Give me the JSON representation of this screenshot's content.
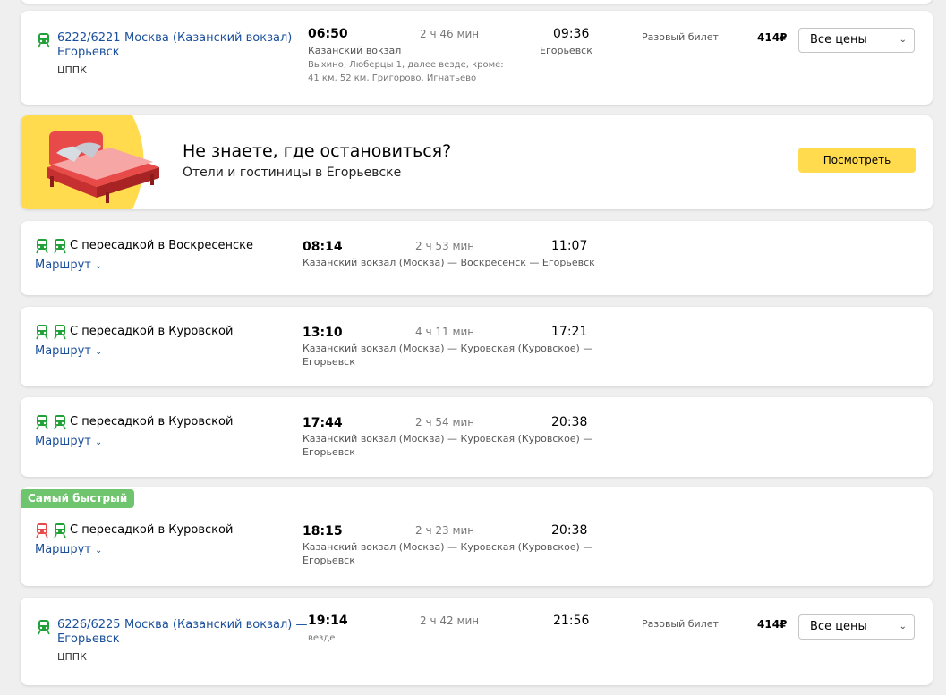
{
  "colors": {
    "train_green": "#21a038",
    "train_red": "#e64a4a",
    "link_blue": "#1a4f9c",
    "badge_green": "#6ec56e",
    "accent_yellow": "#ffdb4d"
  },
  "card1": {
    "number": "6222/6221",
    "route_line1": "Москва (Казанский вокзал) —",
    "route_line2": "Егорьевск",
    "carrier": "ЦППК",
    "dep_time": "06:50",
    "dep_station": "Казанский вокзал",
    "stops_line1": "Выхино, Люберцы 1, далее везде, кроме:",
    "stops_line2": "41 км, 52 км, Григорово, Игнатьево",
    "duration": "2 ч 46 мин",
    "arr_time": "09:36",
    "arr_station": "Егорьевск",
    "ticket_type": "Разовый билет",
    "price": "414₽",
    "select_label": "Все цены"
  },
  "promo": {
    "title": "Не знаете, где остановиться?",
    "subtitle": "Отели и гостиницы в Егорьевске",
    "button": "Посмотреть"
  },
  "transfers": [
    {
      "title": "С пересадкой в Воскресенске",
      "route_link": "Маршрут",
      "dep_time": "08:14",
      "duration": "2 ч 53 мин",
      "arr_time": "11:07",
      "path_line1": "Казанский вокзал (Москва) — Воскресенск — Егорьевск",
      "path_line2": ""
    },
    {
      "title": "С пересадкой в Куровской",
      "route_link": "Маршрут",
      "dep_time": "13:10",
      "duration": "4 ч 11 мин",
      "arr_time": "17:21",
      "path_line1": "Казанский вокзал (Москва) — Куровская (Куровское) —",
      "path_line2": "Егорьевск"
    },
    {
      "title": "С пересадкой в Куровской",
      "route_link": "Маршрут",
      "dep_time": "17:44",
      "duration": "2 ч 54 мин",
      "arr_time": "20:38",
      "path_line1": "Казанский вокзал (Москва) — Куровская (Куровское) —",
      "path_line2": "Егорьевск"
    },
    {
      "badge": "Самый быстрый",
      "title": "С пересадкой в Куровской",
      "route_link": "Маршрут",
      "dep_time": "18:15",
      "duration": "2 ч 23 мин",
      "arr_time": "20:38",
      "path_line1": "Казанский вокзал (Москва) — Куровская (Куровское) —",
      "path_line2": "Егорьевск"
    }
  ],
  "card_last": {
    "number": "6226/6225",
    "route_line1": "Москва (Казанский вокзал) —",
    "route_line2": "Егорьевск",
    "carrier": "ЦППК",
    "dep_time": "19:14",
    "stops": "везде",
    "duration": "2 ч 42 мин",
    "arr_time": "21:56",
    "ticket_type": "Разовый билет",
    "price": "414₽",
    "select_label": "Все цены"
  }
}
